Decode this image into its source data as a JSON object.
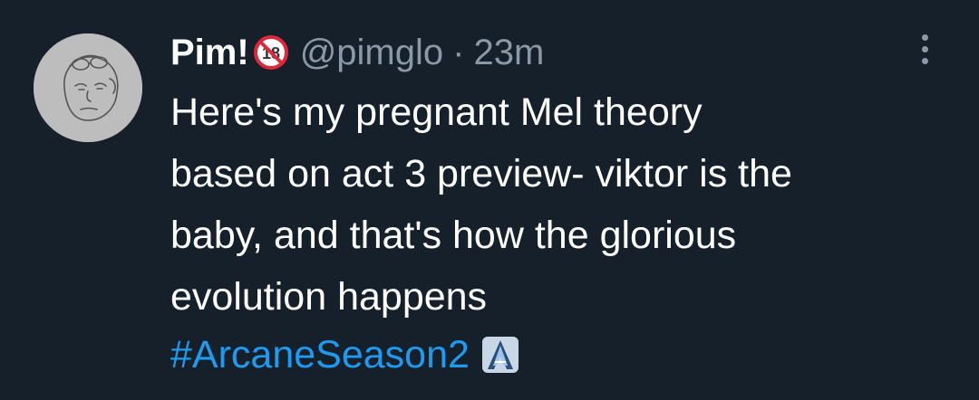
{
  "tweet": {
    "display_name": "Pim!",
    "badge_icon": "no-one-under-18-icon",
    "handle": "@pimglo",
    "separator": "·",
    "time": "23m",
    "body_lines": [
      "Here's my pregnant Mel theory",
      "based on act 3 preview- viktor is the",
      "baby, and that's how the glorious",
      "evolution happens"
    ],
    "hashtag": "#ArcaneSeason2",
    "hashflag_icon": "arcane-logo-icon",
    "more_icon": "more-vertical-icon"
  },
  "colors": {
    "background": "#16202b",
    "text": "#ffffff",
    "secondary_text": "#8b98a5",
    "link": "#1d9bf0",
    "badge_red": "#e0273a"
  }
}
